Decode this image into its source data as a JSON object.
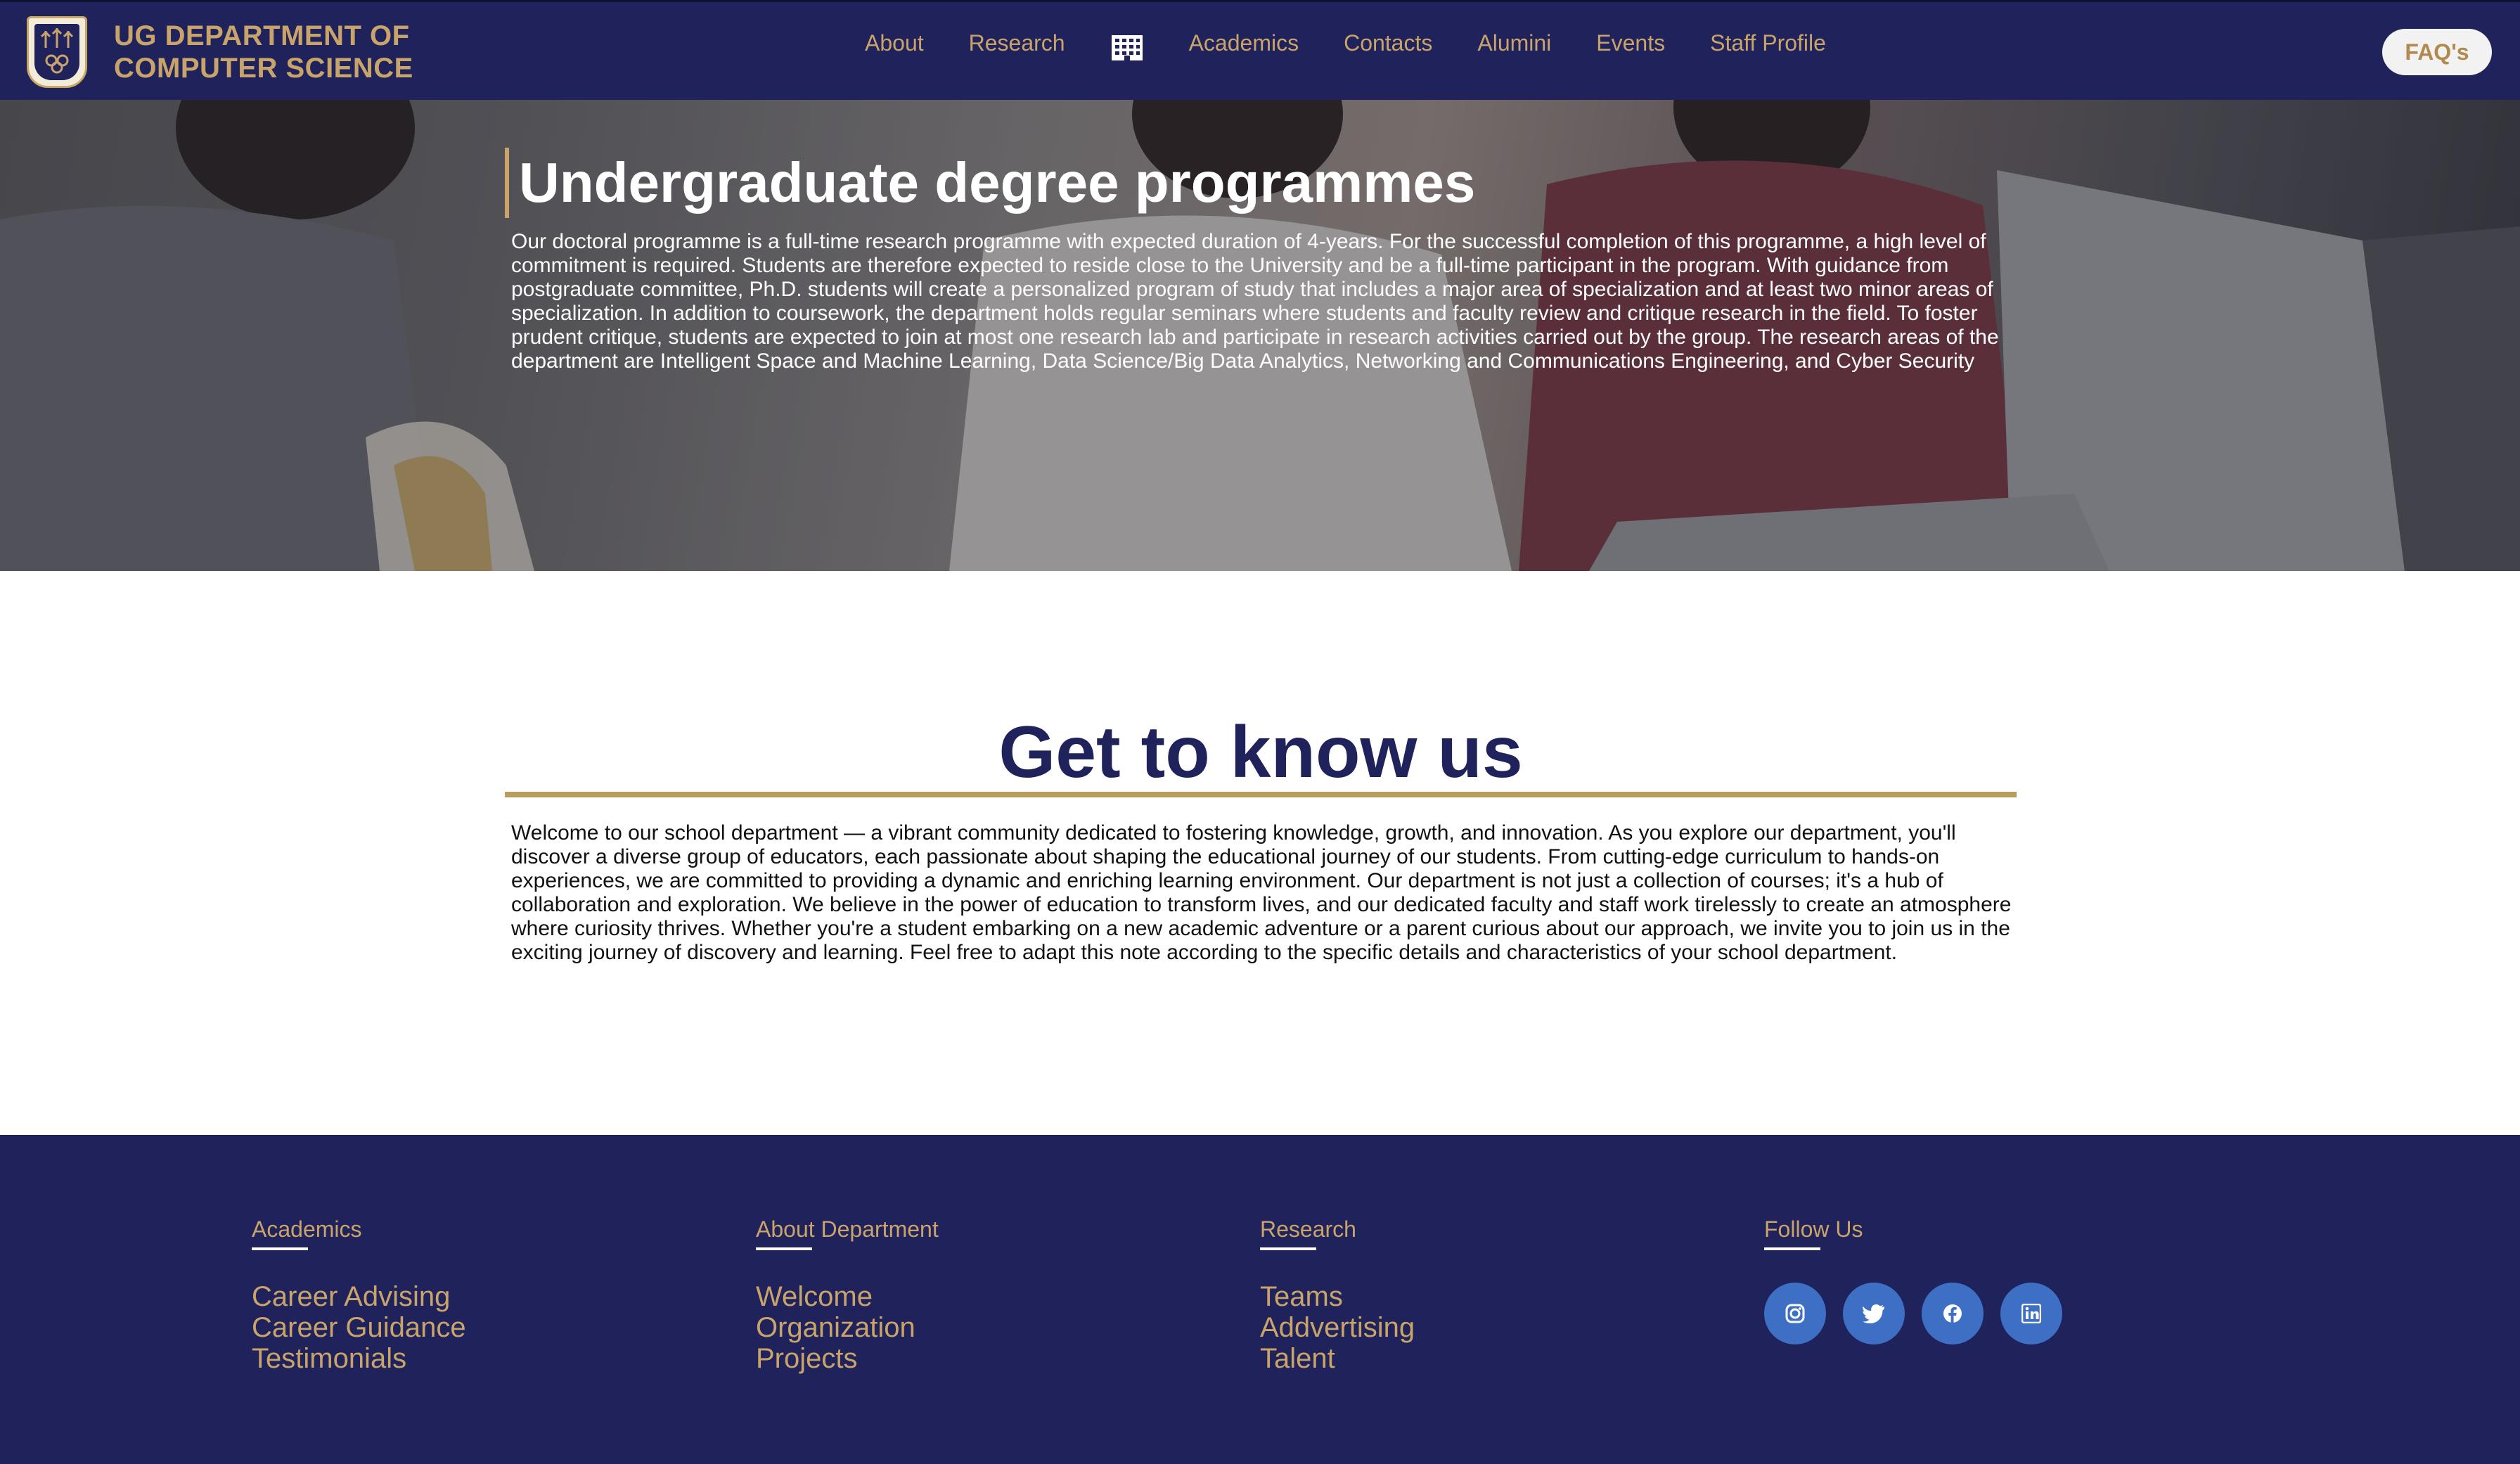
{
  "header": {
    "brand_line1": "UG DEPARTMENT OF",
    "brand_line2": "COMPUTER SCIENCE",
    "nav": [
      {
        "label": "About"
      },
      {
        "label": "Research"
      },
      {
        "icon": "building-icon"
      },
      {
        "label": "Academics"
      },
      {
        "label": "Contacts"
      },
      {
        "label": "Alumini"
      },
      {
        "label": "Events"
      },
      {
        "label": "Staff Profile"
      }
    ],
    "faq_label": "FAQ's"
  },
  "hero": {
    "title": "Undergraduate degree programmes",
    "text": "Our doctoral programme is a full-time research programme with expected duration of 4-years. For the successful completion of this programme, a high level of commitment is required. Students are therefore expected to reside close to the University and be a full-time participant in the program. With guidance from postgraduate committee, Ph.D. students will create a personalized program of study that includes a major area of specialization and at least two minor areas of specialization. In addition to coursework, the department holds regular seminars where students and faculty review and critique research in the field. To foster prudent critique, students are expected to join at most one research lab and participate in research activities carried out by the group. The research areas of the department are Intelligent Space and Machine Learning, Data Science/Big Data Analytics, Networking and Communications Engineering, and Cyber Security"
  },
  "about": {
    "title": "Get to know us",
    "text": "Welcome to our school department — a vibrant community dedicated to fostering knowledge, growth, and innovation. As you explore our department, you'll discover a diverse group of educators, each passionate about shaping the educational journey of our students. From cutting-edge curriculum to hands-on experiences, we are committed to providing a dynamic and enriching learning environment. Our department is not just a collection of courses; it's a hub of collaboration and exploration. We believe in the power of education to transform lives, and our dedicated faculty and staff work tirelessly to create an atmosphere where curiosity thrives. Whether you're a student embarking on a new academic adventure or a parent curious about our approach, we invite you to join us in the exciting journey of discovery and learning. Feel free to adapt this note according to the specific details and characteristics of your school department."
  },
  "footer": {
    "academics": {
      "heading": "Academics",
      "links": [
        "Career Advising",
        "Career Guidance",
        "Testimonials"
      ]
    },
    "about_department": {
      "heading": "About Department",
      "links": [
        "Welcome",
        "Organization",
        "Projects"
      ]
    },
    "research": {
      "heading": "Research",
      "links": [
        "Teams",
        "Addvertising",
        "Talent"
      ]
    },
    "follow": {
      "heading": "Follow Us",
      "social": [
        "instagram-icon",
        "twitter-icon",
        "facebook-icon",
        "linkedin-icon"
      ]
    }
  },
  "colors": {
    "navy": "#20225c",
    "gold": "#c9a46a",
    "social_blue": "#3d6fc4"
  }
}
